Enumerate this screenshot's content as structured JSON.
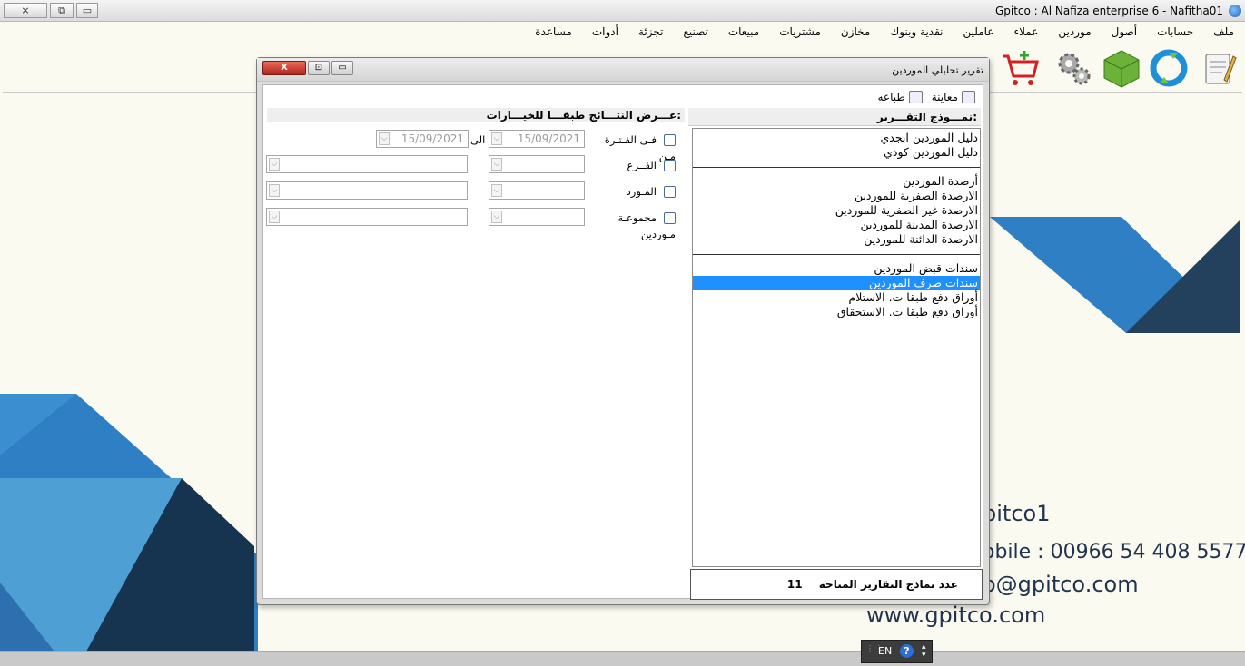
{
  "app": {
    "title": "Gpitco : Al Nafiza enterprise 6  -  Nafitha01",
    "window_buttons": {
      "close": "⨯",
      "restore": "⧉",
      "minimize": "▭"
    }
  },
  "menu": [
    "ملف",
    "حسابات",
    "أصول",
    "موردين",
    "عملاء",
    "عاملين",
    "نقدية وبنوك",
    "مخازن",
    "مشتريات",
    "مبيعات",
    "تصنيع",
    "تجزئة",
    "أدوات",
    "مساعدة"
  ],
  "toolbar_icons": [
    "notes-icon",
    "refresh-icon",
    "box-icon",
    "settings-icon",
    "cart-icon"
  ],
  "background": {
    "company": "pitco1",
    "mobile": "obile : 00966 54 408 5577",
    "email": "o@gpitco.com",
    "website": "www.gpitco.com"
  },
  "langbar": {
    "lang": "EN",
    "help": "?"
  },
  "dialog": {
    "title": "تقرير تحليلي الموردين",
    "buttons": {
      "close": "X",
      "restore": "⊡",
      "minimize": "▭"
    },
    "tools": {
      "preview": "معاينة",
      "print": "طباعه"
    },
    "report_panel": {
      "header": "نمـــوذج التقـــرير:",
      "items": [
        {
          "label": "دليل الموردين ابجدي",
          "selected": false
        },
        {
          "label": "دليل الموردين كودي",
          "selected": false
        },
        {
          "label": "أرصدة الموردين",
          "selected": false
        },
        {
          "label": "الارصدة الصفرية للموردين",
          "selected": false
        },
        {
          "label": "الارصدة غير الصفرية للموردين",
          "selected": false
        },
        {
          "label": "الارصدة المدينة للموردين",
          "selected": false
        },
        {
          "label": "الارصدة الدائنة للموردين",
          "selected": false
        },
        {
          "label": "سندات قبض الموردين",
          "selected": false
        },
        {
          "label": "سندات صرف الموردين",
          "selected": true
        },
        {
          "label": "أوراق دفع طبقا ت. الاستلام",
          "selected": false
        },
        {
          "label": "أوراق دفع طبقا ت. الاستحقاق",
          "selected": false
        }
      ],
      "count_label": "عدد نماذج التقارير المتاحة",
      "count_value": "11"
    },
    "options_panel": {
      "header": "عـــرض النتـــائج طبقـــا للخيـــارات:",
      "period_label": "فـى الفـتـرة مـن",
      "date_from": "15/09/2021",
      "to_label": "الى",
      "date_to": "15/09/2021",
      "branch_label": "الفــرع",
      "supplier_label": "المـورد",
      "group_label": "مجموعـة مـوردين",
      "dropdown_glyph": "⌵"
    }
  }
}
